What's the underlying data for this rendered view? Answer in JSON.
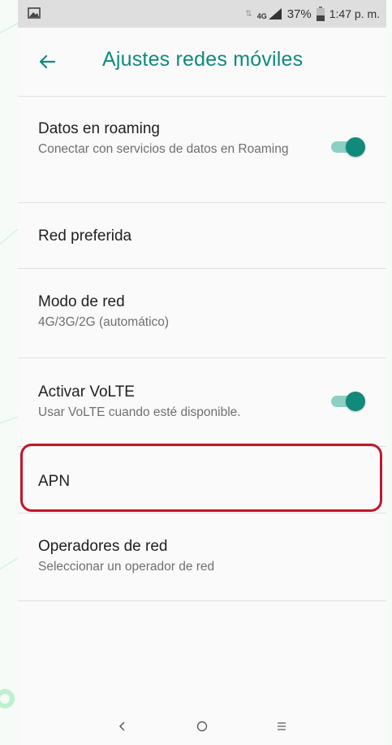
{
  "status_bar": {
    "network": "4G",
    "battery": "37%",
    "time": "1:47 p. m."
  },
  "app_bar": {
    "title": "Ajustes redes móviles"
  },
  "settings": [
    {
      "title": "Datos en roaming",
      "subtitle": "Conectar con servicios de datos en Roaming",
      "toggle": true
    },
    {
      "title": "Red preferida",
      "subtitle": "",
      "toggle": null
    },
    {
      "title": "Modo de red",
      "subtitle": "4G/3G/2G (automático)",
      "toggle": null
    },
    {
      "title": "Activar VoLTE",
      "subtitle": "Usar VoLTE cuando esté disponible.",
      "toggle": true
    },
    {
      "title": "APN",
      "subtitle": "",
      "toggle": null
    },
    {
      "title": "Operadores de red",
      "subtitle": "Seleccionar un operador de red",
      "toggle": null
    }
  ],
  "colors": {
    "accent": "#0e8a7e",
    "toggle_thumb": "#12897b",
    "toggle_track": "#8ecfc4",
    "highlight": "#c0172a"
  },
  "icons": {
    "back": "arrow-left-icon",
    "nav_back": "chevron-left-icon",
    "nav_home": "circle-icon",
    "nav_menu": "menu-icon"
  }
}
